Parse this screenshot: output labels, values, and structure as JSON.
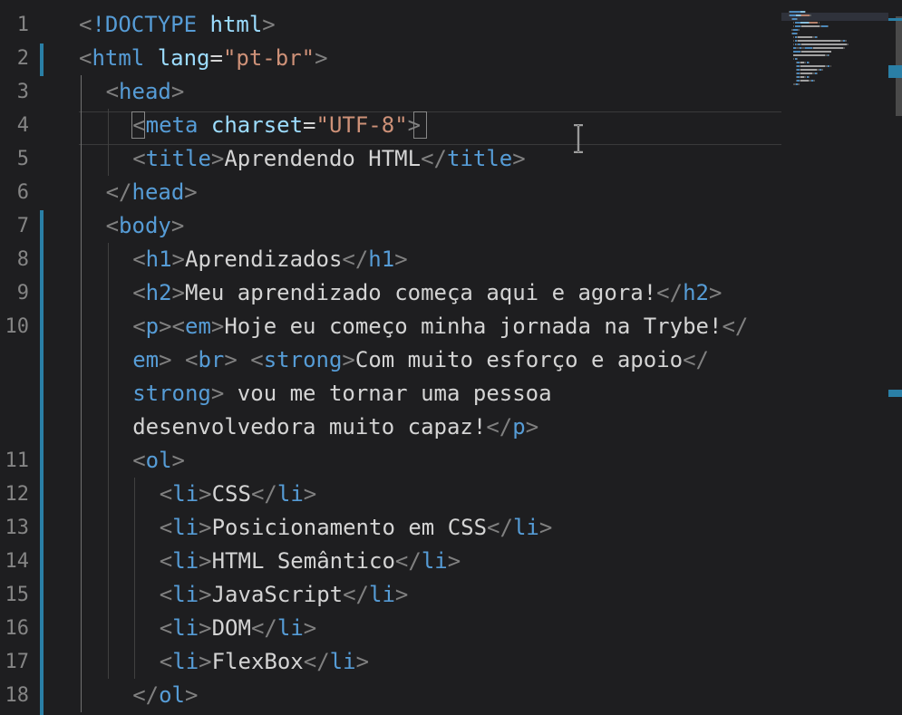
{
  "editor": {
    "language": "html",
    "lines": [
      {
        "num": "1",
        "tokens": [
          [
            "tb",
            "<"
          ],
          [
            "tag",
            "!DOCTYPE "
          ],
          [
            "attr",
            "html"
          ],
          [
            "tb",
            ">"
          ]
        ]
      },
      {
        "num": "2",
        "tokens": [
          [
            "tb",
            "<"
          ],
          [
            "tag",
            "html "
          ],
          [
            "attr",
            "lang"
          ],
          [
            "txt",
            "="
          ],
          [
            "str",
            "\"pt-br\""
          ],
          [
            "tb",
            ">"
          ]
        ]
      },
      {
        "num": "3",
        "tokens": [
          [
            "tb",
            "<"
          ],
          [
            "tag",
            "head"
          ],
          [
            "tb",
            ">"
          ]
        ]
      },
      {
        "num": "4",
        "tokens": [
          [
            "tb",
            "<"
          ],
          [
            "tag",
            "meta "
          ],
          [
            "attr",
            "charset"
          ],
          [
            "txt",
            "="
          ],
          [
            "str",
            "\"UTF-8\""
          ],
          [
            "tb",
            ">"
          ]
        ]
      },
      {
        "num": "5",
        "tokens": [
          [
            "tb",
            "<"
          ],
          [
            "tag",
            "title"
          ],
          [
            "tb",
            ">"
          ],
          [
            "txt",
            "Aprendendo HTML"
          ],
          [
            "tb",
            "</"
          ],
          [
            "tag",
            "title"
          ],
          [
            "tb",
            ">"
          ]
        ]
      },
      {
        "num": "6",
        "tokens": [
          [
            "tb",
            "</"
          ],
          [
            "tag",
            "head"
          ],
          [
            "tb",
            ">"
          ]
        ]
      },
      {
        "num": "7",
        "tokens": [
          [
            "tb",
            "<"
          ],
          [
            "tag",
            "body"
          ],
          [
            "tb",
            ">"
          ]
        ]
      },
      {
        "num": "8",
        "tokens": [
          [
            "tb",
            "<"
          ],
          [
            "tag",
            "h1"
          ],
          [
            "tb",
            ">"
          ],
          [
            "txt",
            "Aprendizados"
          ],
          [
            "tb",
            "</"
          ],
          [
            "tag",
            "h1"
          ],
          [
            "tb",
            ">"
          ]
        ]
      },
      {
        "num": "9",
        "tokens": [
          [
            "tb",
            "<"
          ],
          [
            "tag",
            "h2"
          ],
          [
            "tb",
            ">"
          ],
          [
            "txt",
            "Meu aprendizado começa aqui e agora!"
          ],
          [
            "tb",
            "</"
          ],
          [
            "tag",
            "h2"
          ],
          [
            "tb",
            ">"
          ]
        ]
      },
      {
        "num": "10",
        "tokens": [
          [
            "tb",
            "<"
          ],
          [
            "tag",
            "p"
          ],
          [
            "tb",
            "><"
          ],
          [
            "tag",
            "em"
          ],
          [
            "tb",
            ">"
          ],
          [
            "txt",
            "Hoje eu começo minha jornada na Trybe!"
          ],
          [
            "tb",
            "</"
          ]
        ]
      },
      {
        "num": "",
        "tokens": [
          [
            "tag",
            "em"
          ],
          [
            "tb",
            "> <"
          ],
          [
            "tag",
            "br"
          ],
          [
            "tb",
            "> <"
          ],
          [
            "tag",
            "strong"
          ],
          [
            "tb",
            ">"
          ],
          [
            "txt",
            "Com muito esforço e apoio"
          ],
          [
            "tb",
            "</"
          ]
        ]
      },
      {
        "num": "",
        "tokens": [
          [
            "tag",
            "strong"
          ],
          [
            "tb",
            ">"
          ],
          [
            "txt",
            " vou me tornar uma pessoa"
          ]
        ]
      },
      {
        "num": "",
        "tokens": [
          [
            "txt",
            "desenvolvedora muito capaz!"
          ],
          [
            "tb",
            "</"
          ],
          [
            "tag",
            "p"
          ],
          [
            "tb",
            ">"
          ]
        ]
      },
      {
        "num": "11",
        "tokens": [
          [
            "tb",
            "<"
          ],
          [
            "tag",
            "ol"
          ],
          [
            "tb",
            ">"
          ]
        ]
      },
      {
        "num": "12",
        "tokens": [
          [
            "tb",
            "<"
          ],
          [
            "tag",
            "li"
          ],
          [
            "tb",
            ">"
          ],
          [
            "txt",
            "CSS"
          ],
          [
            "tb",
            "</"
          ],
          [
            "tag",
            "li"
          ],
          [
            "tb",
            ">"
          ]
        ]
      },
      {
        "num": "13",
        "tokens": [
          [
            "tb",
            "<"
          ],
          [
            "tag",
            "li"
          ],
          [
            "tb",
            ">"
          ],
          [
            "txt",
            "Posicionamento em CSS"
          ],
          [
            "tb",
            "</"
          ],
          [
            "tag",
            "li"
          ],
          [
            "tb",
            ">"
          ]
        ]
      },
      {
        "num": "14",
        "tokens": [
          [
            "tb",
            "<"
          ],
          [
            "tag",
            "li"
          ],
          [
            "tb",
            ">"
          ],
          [
            "txt",
            "HTML Semântico"
          ],
          [
            "tb",
            "</"
          ],
          [
            "tag",
            "li"
          ],
          [
            "tb",
            ">"
          ]
        ]
      },
      {
        "num": "15",
        "tokens": [
          [
            "tb",
            "<"
          ],
          [
            "tag",
            "li"
          ],
          [
            "tb",
            ">"
          ],
          [
            "txt",
            "JavaScript"
          ],
          [
            "tb",
            "</"
          ],
          [
            "tag",
            "li"
          ],
          [
            "tb",
            ">"
          ]
        ]
      },
      {
        "num": "16",
        "tokens": [
          [
            "tb",
            "<"
          ],
          [
            "tag",
            "li"
          ],
          [
            "tb",
            ">"
          ],
          [
            "txt",
            "DOM"
          ],
          [
            "tb",
            "</"
          ],
          [
            "tag",
            "li"
          ],
          [
            "tb",
            ">"
          ]
        ]
      },
      {
        "num": "17",
        "tokens": [
          [
            "tb",
            "<"
          ],
          [
            "tag",
            "li"
          ],
          [
            "tb",
            ">"
          ],
          [
            "txt",
            "FlexBox"
          ],
          [
            "tb",
            "</"
          ],
          [
            "tag",
            "li"
          ],
          [
            "tb",
            ">"
          ]
        ]
      },
      {
        "num": "18",
        "tokens": [
          [
            "tb",
            "</"
          ],
          [
            "tag",
            "ol"
          ],
          [
            "tb",
            ">"
          ]
        ]
      }
    ],
    "active_line": "4",
    "colors": {
      "background": "#1e1e20",
      "tag": "#569cd6",
      "attribute": "#9cdcfe",
      "string": "#ce9178",
      "text": "#d4d4d4",
      "bracket": "#808080",
      "line_number": "#858585",
      "git_modified": "#2a7fa6"
    },
    "cursor_icon": "i-beam-cursor-icon"
  }
}
